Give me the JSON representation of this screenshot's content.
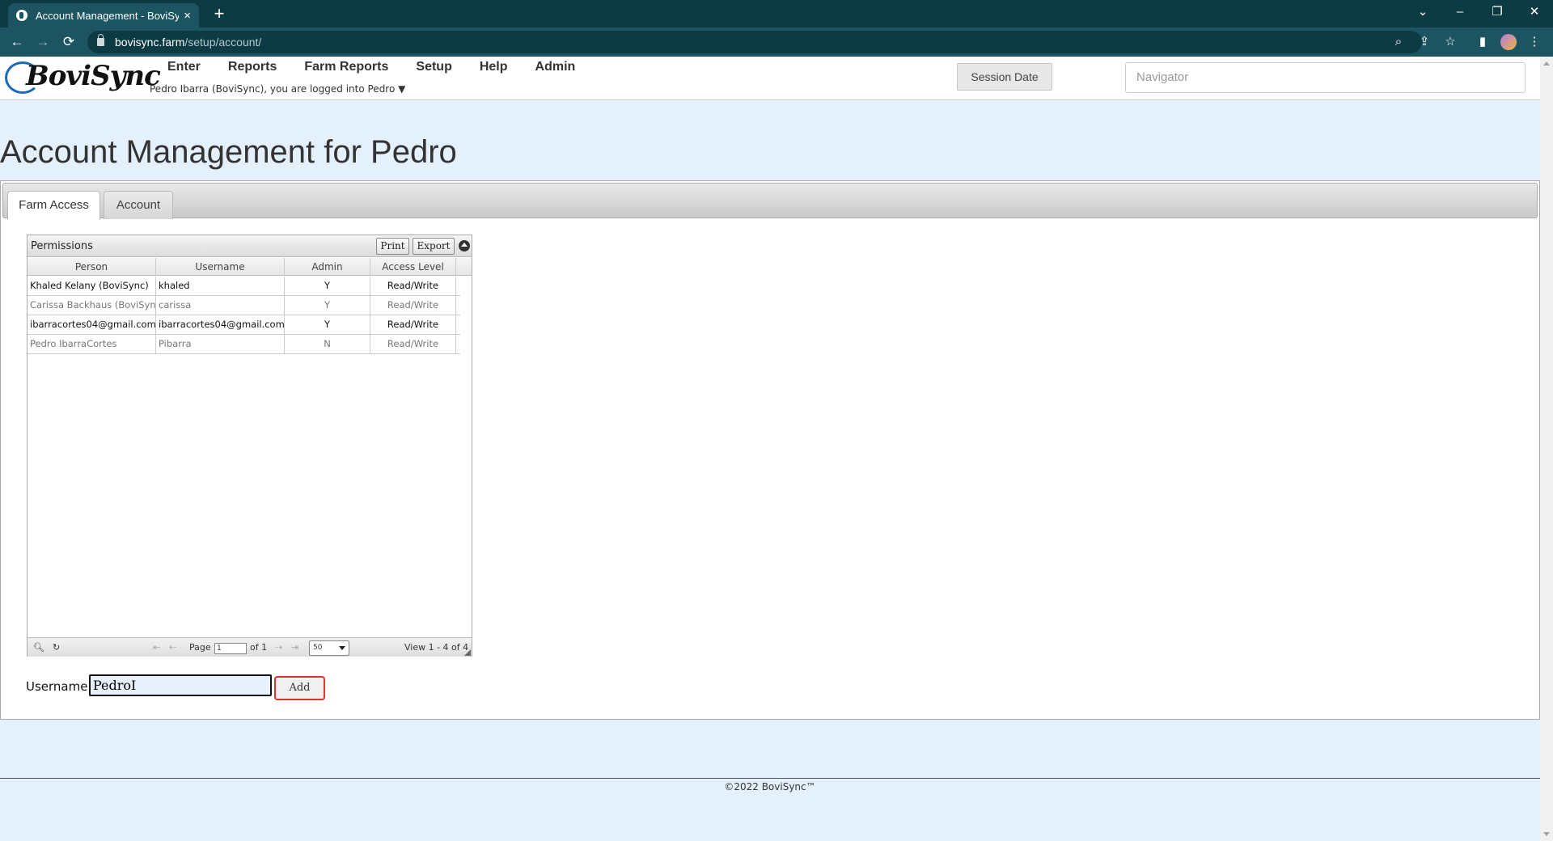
{
  "browser": {
    "tab_title": "Account Management - BoviSync",
    "tab_close": "×",
    "new_tab": "+",
    "url_domain": "bovisync.farm",
    "url_path": "/setup/account/",
    "window_controls": [
      "⌄",
      "–",
      "❐",
      "✕"
    ],
    "nav_icons": [
      "←",
      "→",
      "⟳"
    ],
    "toolbar_icons": [
      "zoom-icon",
      "share-icon",
      "star-icon",
      "sidebar-icon",
      "profile-avatar",
      "menu-icon"
    ]
  },
  "header": {
    "logo_text": "BoviSync",
    "nav": [
      "Enter",
      "Reports",
      "Farm Reports",
      "Setup",
      "Help",
      "Admin"
    ],
    "logged_in_text": "Pedro Ibarra (BoviSync), you are logged into Pedro ▼",
    "session_date_label": "Session Date",
    "navigator_placeholder": "Navigator"
  },
  "page": {
    "title": "Account Management for Pedro",
    "tabs": [
      {
        "label": "Farm Access",
        "active": true
      },
      {
        "label": "Account",
        "active": false
      }
    ]
  },
  "permissions": {
    "caption": "Permissions",
    "print_label": "Print",
    "export_label": "Export",
    "columns": [
      "Person",
      "Username",
      "Admin",
      "Access Level"
    ],
    "rows": [
      {
        "person": "Khaled Kelany (BoviSync)",
        "username": "khaled",
        "admin": "Y",
        "access": "Read/Write",
        "muted": false
      },
      {
        "person": "Carissa Backhaus (BoviSync)",
        "username": "carissa",
        "admin": "Y",
        "access": "Read/Write",
        "muted": true
      },
      {
        "person": "ibarracortes04@gmail.com",
        "username": "ibarracortes04@gmail.com",
        "admin": "Y",
        "access": "Read/Write",
        "muted": false
      },
      {
        "person": "Pedro IbarraCortes",
        "username": "Pibarra",
        "admin": "N",
        "access": "Read/Write",
        "muted": true
      }
    ],
    "pager": {
      "first": "⇤",
      "prev": "⇠",
      "page_label": "Page",
      "page_value": "1",
      "of_label": "of 1",
      "next": "⇢",
      "last": "⇥",
      "page_size": "50",
      "view_text": "View 1 - 4 of 4",
      "search_icon": "🔍︎",
      "refresh_icon": "↻"
    }
  },
  "add_user": {
    "label": "Username:",
    "value": "PedroI",
    "button": "Add"
  },
  "footer": {
    "copyright": "©2022 BoviSync™"
  }
}
